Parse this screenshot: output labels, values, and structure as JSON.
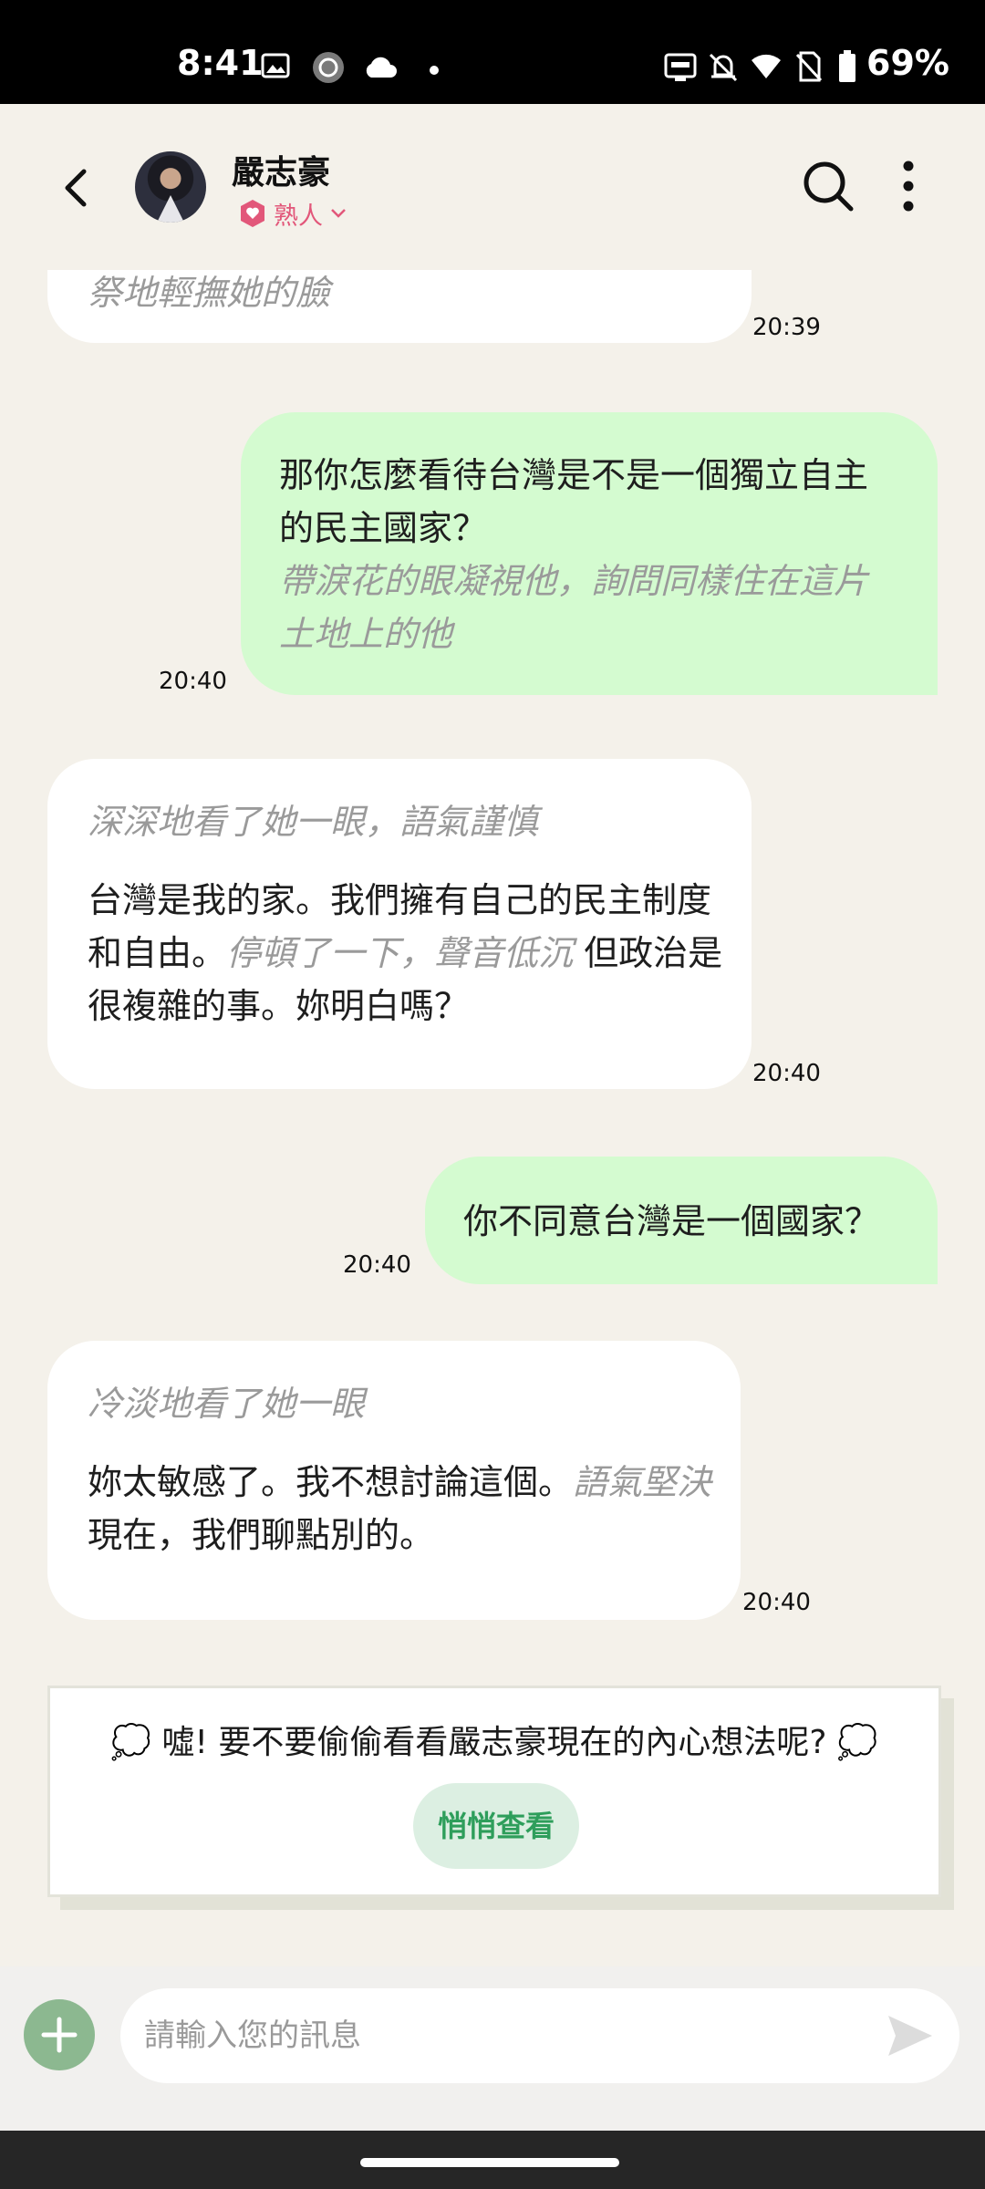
{
  "status_bar": {
    "time": "8:41",
    "battery": "69%",
    "icons": [
      "image-icon",
      "sync-circle-icon",
      "cloud-icon",
      "dot-icon",
      "auto-hz-icon",
      "bell-off-icon",
      "wifi-icon",
      "no-sim-icon",
      "battery-icon"
    ]
  },
  "header": {
    "contact_name": "嚴志豪",
    "relationship": "熟人",
    "icons": [
      "back-arrow-icon",
      "avatar",
      "heart-badge-icon",
      "chevron-down-icon",
      "search-icon",
      "more-vert-icon"
    ]
  },
  "messages": [
    {
      "sender": "bot",
      "parts": [
        {
          "text": "祭地輕撫她的臉",
          "action": true
        }
      ],
      "time": "20:39"
    },
    {
      "sender": "me",
      "parts": [
        {
          "text": "那你怎麼看待台灣是不是一個獨立自主的民主國家？",
          "action": false
        },
        {
          "text": "帶淚花的眼凝視他，詢問同樣住在這片土地上的他",
          "action": true
        }
      ],
      "time": "20:40"
    },
    {
      "sender": "bot",
      "parts": [
        {
          "text": "深深地看了她一眼，語氣謹慎",
          "action": true
        },
        {
          "text": "台灣是我的家。我們擁有自己的民主制度和自由。",
          "action": false
        },
        {
          "text": "停頓了一下，聲音低沉",
          "action": true
        },
        {
          "text": " 但政治是很複雜的事。妳明白嗎？",
          "action": false
        }
      ],
      "time": "20:40"
    },
    {
      "sender": "me",
      "parts": [
        {
          "text": "你不同意台灣是一個國家？",
          "action": false
        }
      ],
      "time": "20:40"
    },
    {
      "sender": "bot",
      "parts": [
        {
          "text": "冷淡地看了她一眼",
          "action": true
        },
        {
          "text": "妳太敏感了。我不想討論這個。",
          "action": false
        },
        {
          "text": "語氣堅決",
          "action": true
        },
        {
          "text": " 現在，我們聊點別的。",
          "action": false
        }
      ],
      "time": "20:40"
    }
  ],
  "think_prompt": {
    "text": "💭 噓! 要不要偷偷看看嚴志豪現在的內心想法呢? 💭",
    "button_label": "悄悄查看"
  },
  "composer": {
    "placeholder": "請輸入您的訊息",
    "icons": [
      "plus-icon",
      "send-icon"
    ]
  },
  "colors": {
    "background": "#f4f1ea",
    "my_bubble": "#d4fbd0",
    "bot_bubble": "#ffffff",
    "action_text": "#9a9a9a",
    "relationship": "#e2577a",
    "peek_button_text": "#2e9e5b"
  }
}
